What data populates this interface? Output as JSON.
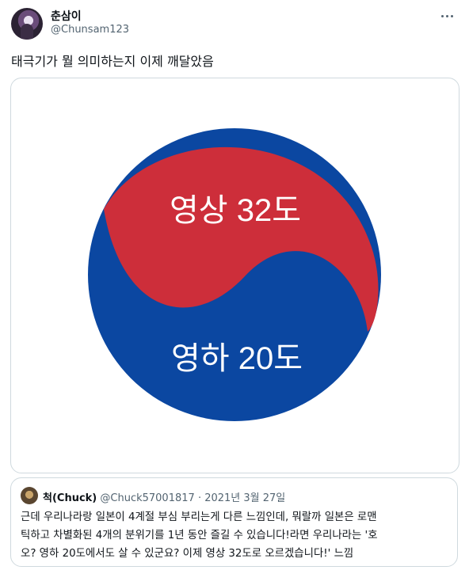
{
  "author": {
    "display_name": "춘삼이",
    "handle": "@Chunsam123"
  },
  "tweet": {
    "text": "태극기가 뭘 의미하는지 이제 깨달았음"
  },
  "image": {
    "top_label": "영상 32도",
    "bottom_label": "영하 20도",
    "colors": {
      "red": "#cd2e3a",
      "blue": "#0b47a1"
    }
  },
  "quote": {
    "display_name": "척(Chuck)",
    "handle": "@Chuck57001817",
    "separator": "·",
    "date": "2021년 3월 27일",
    "text": "근데 우리나라랑 일본이 4계절 부심 부리는게 다른 느낌인데, 뭐랄까 일본은 로맨\n틱하고 차별화된 4개의 분위기를 1년 동안 즐길 수 있습니다!라면 우리나라는 '호\n오? 영하 20도에서도 살 수 있군요? 이제 영상 32도로 오르겠습니다!' 느낌"
  }
}
